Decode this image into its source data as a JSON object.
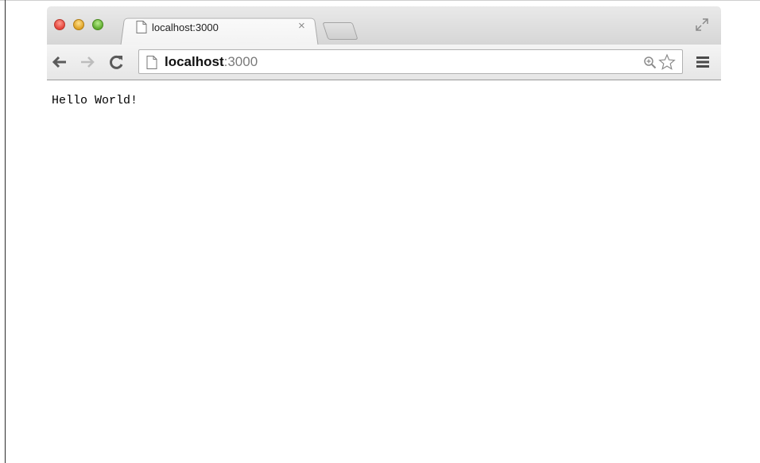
{
  "tab": {
    "title": "localhost:3000",
    "close_symbol": "×"
  },
  "address_bar": {
    "host": "localhost",
    "port": ":3000"
  },
  "page": {
    "body_text": "Hello World!"
  },
  "icons": {
    "close": "traffic-close-icon",
    "minimize": "traffic-minimize-icon",
    "maximize": "traffic-maximize-icon",
    "fullscreen": "fullscreen-icon",
    "back": "back-arrow-icon",
    "forward": "forward-arrow-icon",
    "reload": "reload-icon",
    "page": "document-icon",
    "zoom": "zoom-icon",
    "bookmark": "star-icon",
    "menu": "hamburger-menu-icon"
  },
  "colors": {
    "close": "#e5433a",
    "minimize": "#dea124",
    "maximize": "#5eab2d",
    "url_port": "#7a7a7a"
  }
}
